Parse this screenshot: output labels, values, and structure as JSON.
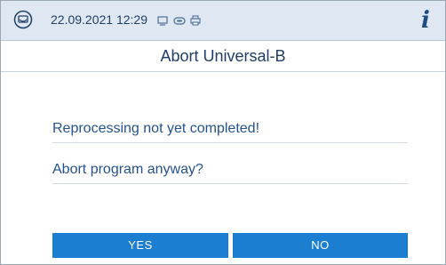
{
  "status": {
    "datetime": "22.09.2021 12:29",
    "icons": [
      "device-tray-icon",
      "monitor-icon",
      "link-icon",
      "printer-icon"
    ],
    "info_icon": "i"
  },
  "dialog": {
    "title": "Abort Universal-B",
    "messages": [
      "Reprocessing not yet completed!",
      "Abort program anyway?"
    ]
  },
  "buttons": {
    "yes": "YES",
    "no": "NO"
  },
  "colors": {
    "accent": "#1b7ed1",
    "status_bg": "#dfe8f2",
    "text": "#24528e"
  }
}
